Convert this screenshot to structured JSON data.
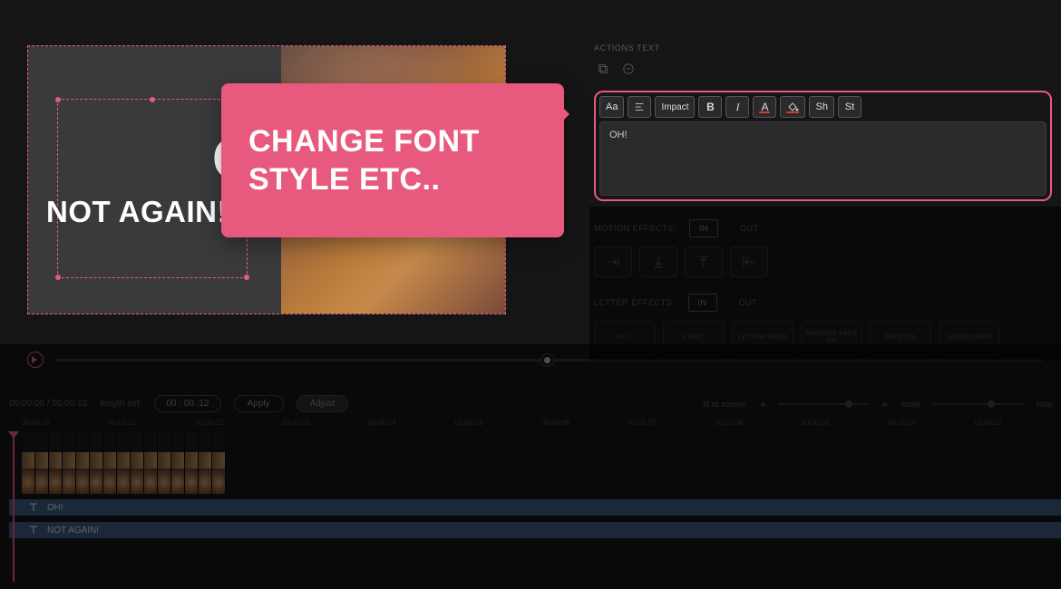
{
  "preview": {
    "text1": "OH!",
    "text2": "NOT AGAIN!"
  },
  "tooltip": {
    "text": "CHANGE FONT STYLE ETC.."
  },
  "panel": {
    "actions_label": "ACTIONS TEXT",
    "toolbar": {
      "aa": "Aa",
      "font": "Impact",
      "bold": "B",
      "italic": "I",
      "color_letter": "A",
      "sh": "Sh",
      "st": "St"
    },
    "editor_value": "OH!",
    "motion": {
      "label": "MOTION EFFECTS:",
      "in": "IN",
      "out": "OUT"
    },
    "letter": {
      "label": "LETTER EFFECTS:",
      "in": "IN",
      "out": "OUT",
      "options": [
        "FLY",
        "PRINT",
        "LETTER DROP",
        "RANDOM FADE UP",
        "FADE ON",
        "WORD DROP"
      ]
    }
  },
  "bottombar": {
    "timecode": "00:00:00 / 00:00:12",
    "length_label": "length set:",
    "length_value": "00 : 00 :12",
    "apply": "Apply",
    "adjust": "Adjust",
    "fit": "fit to screen",
    "scale": "scale",
    "hide": "hide"
  },
  "ruler": [
    "00:00:00",
    "00:00:01",
    "00:00:02",
    "00:00:03",
    "00:00:04",
    "00:00:05",
    "00:00:06",
    "00:00:07",
    "00:00:08",
    "00:00:09",
    "00:00:10",
    "00:00:11"
  ],
  "tracks": {
    "t1": "OH!",
    "t2": "NOT AGAIN!"
  }
}
